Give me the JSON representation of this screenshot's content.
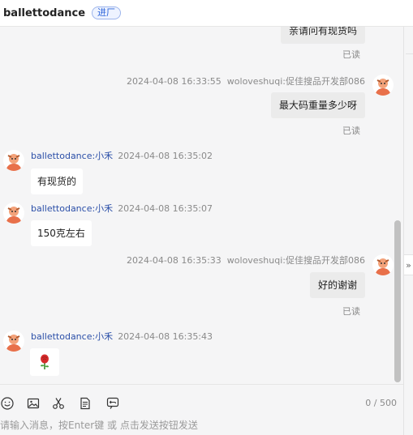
{
  "header": {
    "title": "ballettodance",
    "badge": "进厂"
  },
  "messages": [
    {
      "direction": "out",
      "text": "亲请问有现货吗",
      "status": "已读"
    },
    {
      "direction": "out",
      "timestamp": "2024-04-08 16:33:55",
      "sender": "woloveshuqi:促佳搜品开发部086",
      "text": "最大码重量多少呀",
      "status": "已读"
    },
    {
      "direction": "in",
      "sender": "ballettodance:小禾",
      "timestamp": "2024-04-08 16:35:02",
      "text": "有现货的"
    },
    {
      "direction": "in",
      "sender": "ballettodance:小禾",
      "timestamp": "2024-04-08 16:35:07",
      "text": "150克左右"
    },
    {
      "direction": "out",
      "timestamp": "2024-04-08 16:35:33",
      "sender": "woloveshuqi:促佳搜品开发部086",
      "text": "好的谢谢",
      "status": "已读"
    },
    {
      "direction": "in",
      "sender": "ballettodance:小禾",
      "timestamp": "2024-04-08 16:35:43",
      "emoji": "rose-emoji"
    }
  ],
  "toolbar": {
    "icons": [
      "smiley-icon",
      "image-icon",
      "scissors-icon",
      "document-icon",
      "recall-icon"
    ],
    "counter": "0 / 500"
  },
  "input": {
    "placeholder": "请输入消息，按Enter键 或 点击发送按钮发送"
  },
  "colors": {
    "accent": "#2b63d9",
    "sender_link": "#2b4fa8",
    "avatar": "#e8704a"
  }
}
